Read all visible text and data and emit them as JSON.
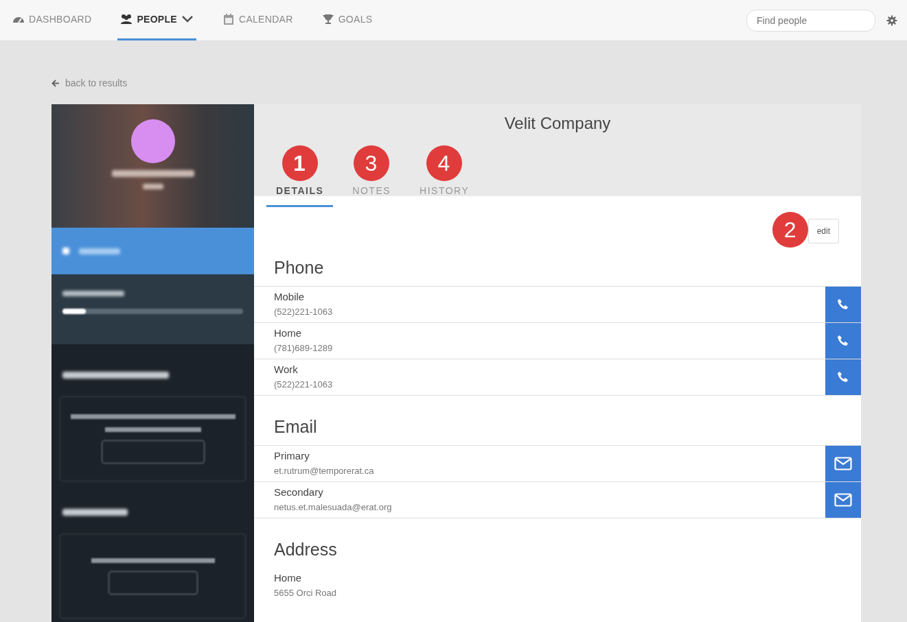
{
  "nav": {
    "items": [
      {
        "kind": "dashboard",
        "label": "DASHBOARD",
        "selected": false
      },
      {
        "kind": "people",
        "label": "PEOPLE",
        "selected": true,
        "dropdown": true
      },
      {
        "kind": "calendar",
        "label": "CALENDAR",
        "selected": false
      },
      {
        "kind": "goals",
        "label": "GOALS",
        "selected": false
      }
    ],
    "search": {
      "placeholder": "Find people"
    }
  },
  "back_link": "back to results",
  "sidebar": {
    "plan_progress": {
      "level": 0.13
    }
  },
  "contact": {
    "title": "Velit Company",
    "tabs": [
      {
        "label": "DETAILS",
        "selected": true,
        "callout": "1"
      },
      {
        "label": "NOTES",
        "selected": false,
        "callout": "3"
      },
      {
        "label": "HISTORY",
        "selected": false,
        "callout": "4"
      }
    ],
    "edit": {
      "label": "edit",
      "callout": "2"
    },
    "sections": [
      {
        "heading": "Phone",
        "kind": "phone",
        "rows": [
          {
            "label": "Mobile",
            "value": "(522)221-1063"
          },
          {
            "label": "Home",
            "value": "(781)689-1289"
          },
          {
            "label": "Work",
            "value": "(522)221-1063"
          }
        ]
      },
      {
        "heading": "Email",
        "kind": "email",
        "rows": [
          {
            "label": "Primary",
            "value": "et.rutrum@temporerat.ca"
          },
          {
            "label": "Secondary",
            "value": "netus.et.malesuada@erat.org"
          }
        ]
      },
      {
        "heading": "Address",
        "kind": "address",
        "rows": [
          {
            "label": "Home",
            "value": "5655 Orci Road"
          }
        ]
      }
    ]
  }
}
